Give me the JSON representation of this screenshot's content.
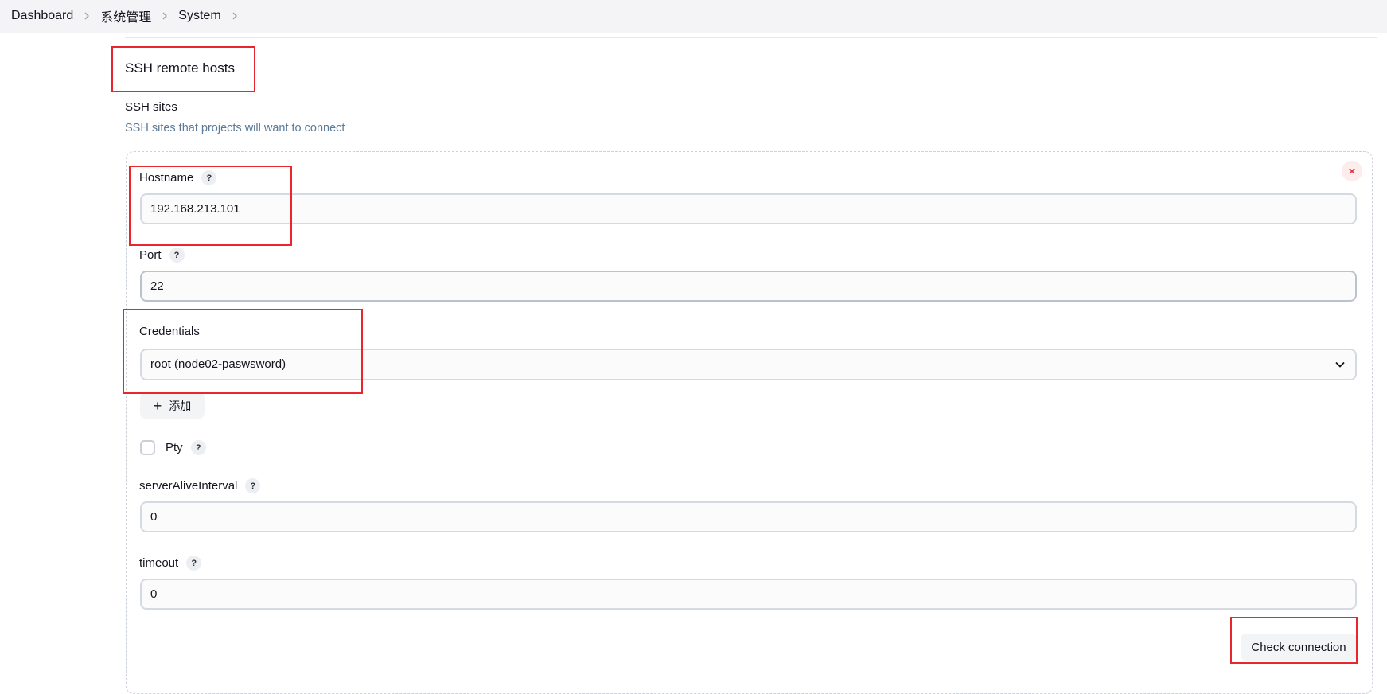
{
  "breadcrumb": {
    "items": [
      "Dashboard",
      "系统管理",
      "System"
    ]
  },
  "section": {
    "title": "SSH remote hosts",
    "sites_label": "SSH sites",
    "sites_description": "SSH sites that projects will want to connect"
  },
  "form": {
    "hostname": {
      "label": "Hostname",
      "value": "192.168.213.101",
      "help": "?"
    },
    "port": {
      "label": "Port",
      "value": "22",
      "help": "?"
    },
    "credentials": {
      "label": "Credentials",
      "value": "root (node02-paswsword)"
    },
    "add_button": {
      "icon": "+",
      "label": "添加"
    },
    "pty": {
      "label": "Pty",
      "checked": false,
      "help": "?"
    },
    "server_alive_interval": {
      "label": "serverAliveInterval",
      "value": "0",
      "help": "?"
    },
    "timeout": {
      "label": "timeout",
      "value": "0",
      "help": "?"
    },
    "check_button": "Check connection",
    "delete_icon": "×"
  },
  "colors": {
    "highlight": "#e8262b",
    "description": "#5a7a96",
    "delete": "#e0323b"
  }
}
